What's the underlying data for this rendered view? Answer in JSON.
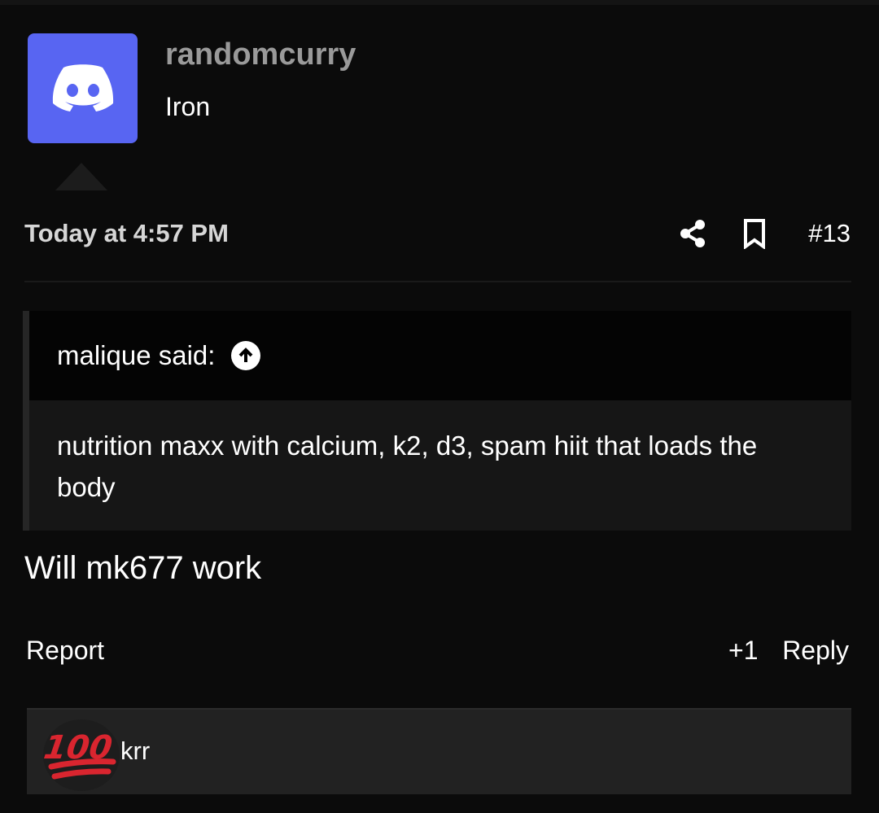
{
  "post": {
    "author": {
      "username": "randomcurry",
      "user_title": "Iron",
      "avatar_icon": "discord-logo-icon",
      "avatar_color": "#5865f2"
    },
    "timestamp": "Today at 4:57 PM",
    "post_number": "#13",
    "actions": {
      "share_icon": "share-icon",
      "bookmark_icon": "bookmark-icon"
    },
    "quote": {
      "author_label": "malique said:",
      "jump_icon": "arrow-up-circle-icon",
      "text": "nutrition maxx with calcium, k2, d3, spam hiit that loads the body"
    },
    "body": "Will mk677 work",
    "footer": {
      "report_label": "Report",
      "react_label": "+1",
      "reply_label": "Reply"
    },
    "reactions": {
      "icon": "hundred-points-icon",
      "users": "krr"
    }
  }
}
